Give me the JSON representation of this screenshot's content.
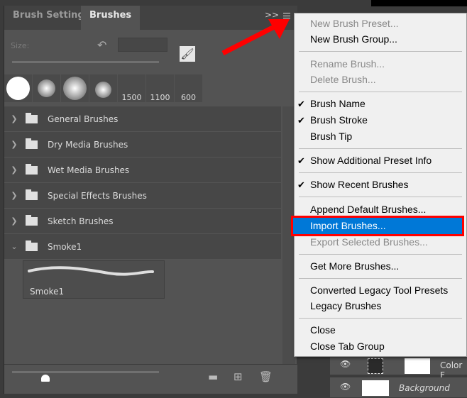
{
  "tabs": [
    {
      "label": "Brush Settings",
      "active": false
    },
    {
      "label": "Brushes",
      "active": true
    }
  ],
  "flyout_icon": ">>",
  "size_label": "Size:",
  "presets": [
    {
      "label": ""
    },
    {
      "label": ""
    },
    {
      "label": ""
    },
    {
      "label": ""
    },
    {
      "label": "1500"
    },
    {
      "label": "1100"
    },
    {
      "label": "600"
    }
  ],
  "groups": [
    {
      "name": "General Brushes",
      "expanded": false
    },
    {
      "name": "Dry Media Brushes",
      "expanded": false
    },
    {
      "name": "Wet Media Brushes",
      "expanded": false
    },
    {
      "name": "Special Effects Brushes",
      "expanded": false
    },
    {
      "name": "Sketch Brushes",
      "expanded": false
    },
    {
      "name": "Smoke1",
      "expanded": true
    }
  ],
  "brush_thumb": {
    "name": "Smoke1"
  },
  "menu": [
    {
      "label": "New Brush Preset...",
      "disabled": true
    },
    {
      "label": "New Brush Group..."
    },
    {
      "label": "Rename Brush...",
      "disabled": true
    },
    {
      "label": "Delete Brush...",
      "disabled": true
    },
    {
      "label": "Brush Name",
      "checked": true
    },
    {
      "label": "Brush Stroke",
      "checked": true
    },
    {
      "label": "Brush Tip"
    },
    {
      "label": "Show Additional Preset Info",
      "checked": true
    },
    {
      "label": "Show Recent Brushes",
      "checked": true
    },
    {
      "label": "Append Default Brushes..."
    },
    {
      "label": "Import Brushes...",
      "highlighted": true
    },
    {
      "label": "Export Selected Brushes...",
      "disabled": true
    },
    {
      "label": "Get More Brushes..."
    },
    {
      "label": "Converted Legacy Tool Presets"
    },
    {
      "label": "Legacy Brushes"
    },
    {
      "label": "Close"
    },
    {
      "label": "Close Tab Group"
    }
  ],
  "layers": [
    {
      "name": "Color F"
    },
    {
      "name": "Background"
    }
  ],
  "colors": {
    "highlight": "#0078d7",
    "annotation": "#ff0000",
    "checkmark": "✔"
  }
}
